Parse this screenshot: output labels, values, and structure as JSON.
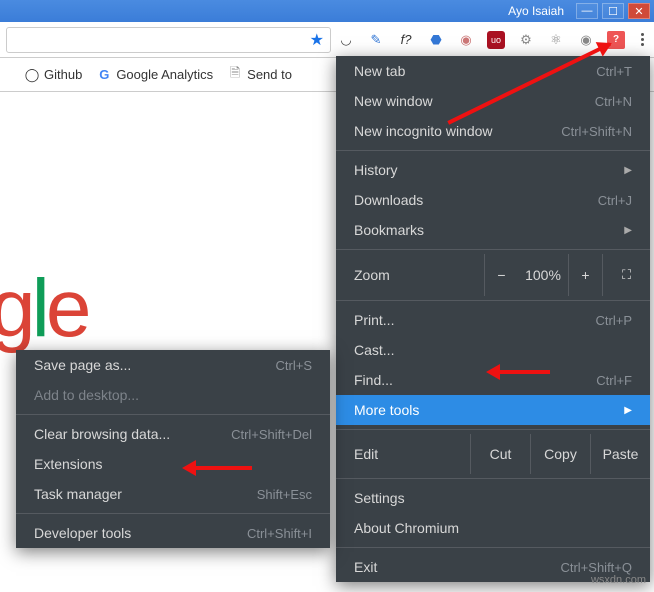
{
  "title_bar": {
    "user": "Ayo Isaiah"
  },
  "bookmarks": {
    "github": "Github",
    "analytics": "Google Analytics",
    "sendto": "Send to"
  },
  "menu": {
    "new_tab": "New tab",
    "new_tab_sc": "Ctrl+T",
    "new_window": "New window",
    "new_window_sc": "Ctrl+N",
    "incognito": "New incognito window",
    "incognito_sc": "Ctrl+Shift+N",
    "history": "History",
    "downloads": "Downloads",
    "downloads_sc": "Ctrl+J",
    "bookmarks": "Bookmarks",
    "zoom": "Zoom",
    "zoom_val": "100%",
    "print": "Print...",
    "print_sc": "Ctrl+P",
    "cast": "Cast...",
    "find": "Find...",
    "find_sc": "Ctrl+F",
    "more_tools": "More tools",
    "edit": "Edit",
    "cut": "Cut",
    "copy": "Copy",
    "paste": "Paste",
    "settings": "Settings",
    "about": "About Chromium",
    "exit": "Exit",
    "exit_sc": "Ctrl+Shift+Q"
  },
  "submenu": {
    "save_page": "Save page as...",
    "save_page_sc": "Ctrl+S",
    "add_desktop": "Add to desktop...",
    "clear_data": "Clear browsing data...",
    "clear_data_sc": "Ctrl+Shift+Del",
    "extensions": "Extensions",
    "task_manager": "Task manager",
    "task_manager_sc": "Shift+Esc",
    "dev_tools": "Developer tools",
    "dev_tools_sc": "Ctrl+Shift+I"
  },
  "watermark": "wsxdn.com"
}
